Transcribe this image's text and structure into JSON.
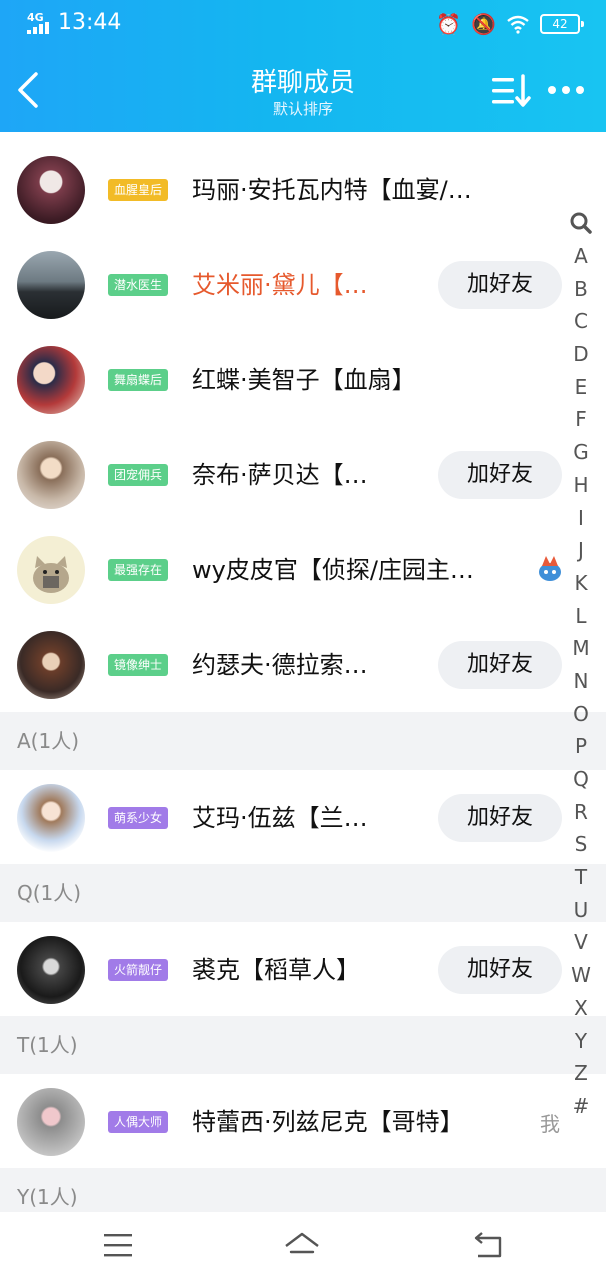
{
  "status": {
    "network": "4G",
    "time": "13:44",
    "battery": "42"
  },
  "header": {
    "title": "群聊成员",
    "subtitle": "默认排序"
  },
  "members": [
    {
      "badge": "血腥皇后",
      "badge_color": "#f2bb27",
      "name": "玛丽·安托瓦内特【血宴/…",
      "name_color": "#111111",
      "action": ""
    },
    {
      "badge": "潜水医生",
      "badge_color": "#5ccf8a",
      "name": "艾米丽·黛儿【…",
      "name_color": "#e6592d",
      "action": "加好友"
    },
    {
      "badge": "舞扇蝶后",
      "badge_color": "#5ccf8a",
      "name": "红蝶·美智子【血扇】",
      "name_color": "#111111",
      "action": ""
    },
    {
      "badge": "团宠佣兵",
      "badge_color": "#5ccf8a",
      "name": "奈布·萨贝达【…",
      "name_color": "#111111",
      "action": "加好友"
    },
    {
      "badge": "最强存在",
      "badge_color": "#5ccf8a",
      "name": "wy皮皮官【侦探/庄园主…",
      "name_color": "#111111",
      "action": ""
    },
    {
      "badge": "镜像绅士",
      "badge_color": "#5ccf8a",
      "name": "约瑟夫·德拉索…",
      "name_color": "#111111",
      "action": "加好友"
    }
  ],
  "sections": [
    {
      "header": "A(1人)",
      "badge": "萌系少女",
      "badge_color": "#a17be8",
      "name": "艾玛·伍兹【兰…",
      "action": "加好友"
    },
    {
      "header": "Q(1人)",
      "badge": "火箭靓仔",
      "badge_color": "#a17be8",
      "name": "裘克【稻草人】",
      "action": "加好友"
    },
    {
      "header": "T(1人)",
      "badge": "人偶大师",
      "badge_color": "#a17be8",
      "name": "特蕾西·列兹尼克【哥特】",
      "action": "",
      "me": "我"
    },
    {
      "header": "Y(1人)"
    }
  ],
  "index_letters": [
    "A",
    "B",
    "C",
    "D",
    "E",
    "F",
    "G",
    "H",
    "I",
    "J",
    "K",
    "L",
    "M",
    "N",
    "O",
    "P",
    "Q",
    "R",
    "S",
    "T",
    "U",
    "V",
    "W",
    "X",
    "Y",
    "Z",
    "#"
  ],
  "icons": {
    "search": "search-icon",
    "back": "back-arrow-icon",
    "sort": "sort-icon",
    "more": "more-dots-icon"
  }
}
